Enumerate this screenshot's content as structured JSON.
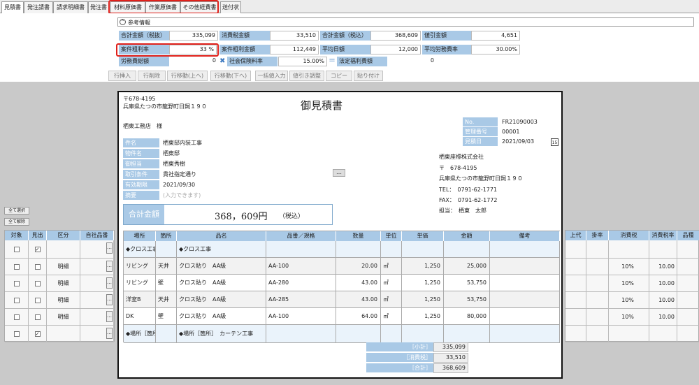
{
  "tabs": [
    "見積書",
    "発注請書",
    "請求明細書",
    "発注書",
    "材料原価書",
    "作業原価書",
    "その他経費書",
    "送付状"
  ],
  "ref_label": "参考情報",
  "summary": [
    {
      "label": "合計金額（税抜）",
      "value": "335,099"
    },
    {
      "label": "消費税金額",
      "value": "33,510"
    },
    {
      "label": "合計金額（税込）",
      "value": "368,609"
    },
    {
      "label": "値引金額",
      "value": "4,651"
    },
    {
      "label": "案件粗利率",
      "value": "33 %"
    },
    {
      "label": "案件粗利金額",
      "value": "112,449"
    },
    {
      "label": "平均日額",
      "value": "12,000"
    },
    {
      "label": "平均労務費率",
      "value": "30.00%"
    },
    {
      "label": "労務費総額",
      "value": "0"
    },
    {
      "label": "社会保険料率",
      "value": "15.00%"
    },
    {
      "label": "法定福利費額",
      "value": "0"
    }
  ],
  "toolbar": [
    "行挿入",
    "行削除",
    "行移動(上へ)",
    "行移動(下へ)",
    "一括値入力",
    "値引き調整",
    "コピー",
    "貼り付け"
  ],
  "left": {
    "select_all": "全て選択",
    "clear_all": "全て解除",
    "headers": [
      "対象",
      "見出",
      "区分",
      "自社品番"
    ],
    "category": [
      "",
      "明細",
      "明細",
      "明細",
      "明細",
      ""
    ]
  },
  "right_headers": [
    "上代",
    "掛率",
    "消費税",
    "消費税率",
    "品種"
  ],
  "right_rows": [
    [
      "",
      "",
      "",
      "",
      ""
    ],
    [
      "",
      "",
      "10%",
      "10.00",
      ""
    ],
    [
      "",
      "",
      "10%",
      "10.00",
      ""
    ],
    [
      "",
      "",
      "10%",
      "10.00",
      ""
    ],
    [
      "",
      "",
      "10%",
      "10.00",
      ""
    ],
    [
      "",
      "",
      "",
      "",
      ""
    ]
  ],
  "doc": {
    "title": "御見積書",
    "postal": "〒678-4195",
    "address": "兵庫県たつの市龍野町日飼１９０",
    "customer": "栖東工務店　様",
    "fields": [
      {
        "label": "件名",
        "value": "栖東邸内装工事"
      },
      {
        "label": "物件名",
        "value": "栖東邸"
      },
      {
        "label": "御担当",
        "value": "栖東秀樹"
      },
      {
        "label": "取引条件",
        "value": "貴社指定通り"
      },
      {
        "label": "有効期限",
        "value": "2021/09/30"
      },
      {
        "label": "摘要",
        "value": "(入力できます)"
      }
    ],
    "meta": [
      {
        "label": "No.",
        "value": "FR21090003"
      },
      {
        "label": "管理番号",
        "value": "00001"
      },
      {
        "label": "見積日",
        "value": "2021/09/03"
      }
    ],
    "calendar_day": "15",
    "company": "栖東座標株式会社",
    "company_postal": "〒　678-4195",
    "company_address": "兵庫県たつの市龍野町日飼１９０",
    "tel": "TEL：　0791-62-1771",
    "fax": "FAX：　0791-62-1772",
    "person": "担当：　栖東　太郎",
    "more_btn": "…",
    "total_label": "合計金額",
    "total_value": "368，609円",
    "total_tax": "（税込）",
    "headers": [
      "場所",
      "箇所",
      "品名",
      "品番／規格",
      "数量",
      "単位",
      "単価",
      "金額",
      "備考"
    ],
    "rows": [
      [
        "◆クロス工事",
        "",
        "◆クロス工事",
        "",
        "",
        "",
        "",
        "",
        ""
      ],
      [
        "リビング",
        "天井",
        "クロス貼り　AA級",
        "AA-100",
        "20.00",
        "㎡",
        "1,250",
        "25,000",
        ""
      ],
      [
        "リビング",
        "壁",
        "クロス貼り　AA級",
        "AA-280",
        "43.00",
        "㎡",
        "1,250",
        "53,750",
        ""
      ],
      [
        "洋室B",
        "天井",
        "クロス貼り　AA級",
        "AA-285",
        "43.00",
        "㎡",
        "1,250",
        "53,750",
        ""
      ],
      [
        "DK",
        "壁",
        "クロス貼り　AA級",
        "AA-100",
        "64.00",
        "㎡",
        "1,250",
        "80,000",
        ""
      ],
      [
        "◆場所［箇所］　カ…",
        "",
        "◆場所［箇所］　カーテン工事",
        "",
        "",
        "",
        "",
        "",
        ""
      ]
    ],
    "totals": [
      {
        "label": "［小計］",
        "value": "335,099"
      },
      {
        "label": "［消費税］",
        "value": "33,510"
      },
      {
        "label": "［合計］",
        "value": "368,609"
      }
    ]
  },
  "colors": {
    "label_bg": "#a9c9e6",
    "highlight": "#e0201a"
  }
}
